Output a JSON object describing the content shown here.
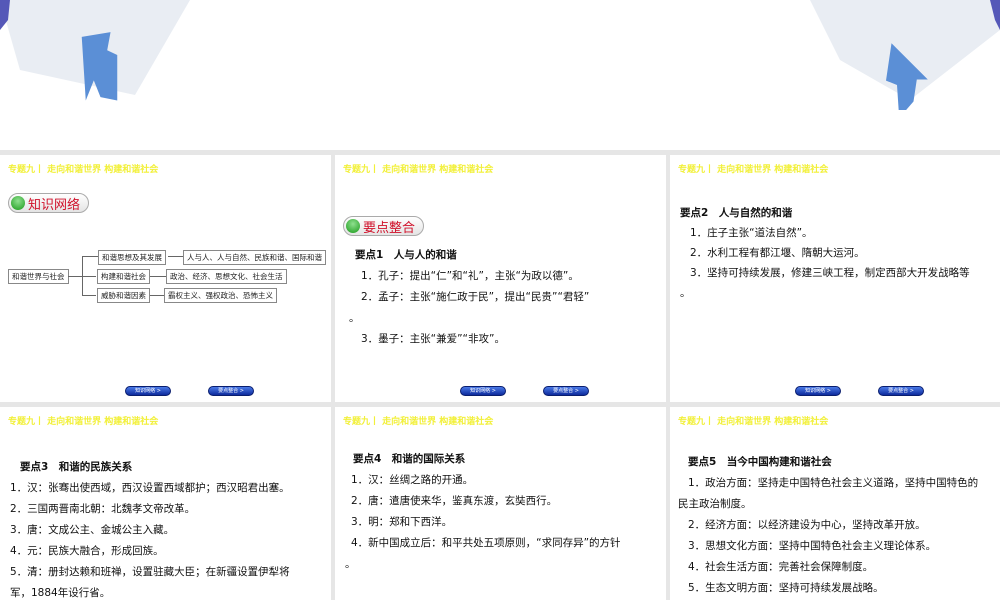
{
  "header": "专题九丨 走向和谐世界 构建和谐社会",
  "nav": {
    "knowledge": "知识网络 >",
    "points": "要点整合 >"
  },
  "slide1": {
    "pill": "知识网络",
    "root": "和谐世界与社会",
    "branches": [
      {
        "label": "和谐思想及其发展",
        "leaf": "人与人、人与自然、民族和谐、国际和谐"
      },
      {
        "label": "构建和谐社会",
        "leaf": "政治、经济、思想文化、社会生活"
      },
      {
        "label": "威胁和谐因素",
        "leaf": "霸权主义、强权政治、恐怖主义"
      }
    ]
  },
  "slide2": {
    "pill": "要点整合",
    "title": "要点1　人与人的和谐",
    "lines": [
      "1．孔子：提出“仁”和“礼”，主张“为政以德”。",
      "2．孟子：主张“施仁政于民”，提出“民贵”“君轻”",
      "。",
      "3．墨子：主张“兼爱”“非攻”。"
    ]
  },
  "slide3": {
    "title": "要点2　人与自然的和谐",
    "lines": [
      "1．庄子主张“道法自然”。",
      "2．水利工程有都江堰、隋朝大运河。",
      "3．坚持可持续发展，修建三峡工程，制定西部大开发战略等",
      "。"
    ]
  },
  "slide4": {
    "title": "要点3　和谐的民族关系",
    "lines": [
      "1．汉：张骞出使西域，西汉设置西域都护；西汉昭君出塞。",
      "2．三国两晋南北朝：北魏孝文帝改革。",
      "3．唐：文成公主、金城公主入藏。",
      "4．元：民族大融合，形成回族。",
      "5．清：册封达赖和班禅，设置驻藏大臣；在新疆设置伊犁将",
      "军，1884年设行省。"
    ]
  },
  "slide5": {
    "title": "要点4　和谐的国际关系",
    "lines": [
      "1．汉：丝绸之路的开通。",
      "2．唐：遣唐使来华，鉴真东渡，玄奘西行。",
      "3．明：郑和下西洋。",
      "4．新中国成立后：和平共处五项原则，“求同存异”的方针",
      "。"
    ]
  },
  "slide6": {
    "title": "要点5　当今中国构建和谐社会",
    "lines": [
      "1．政治方面：坚持走中国特色社会主义道路，坚持中国特色的",
      "民主政治制度。",
      "2．经济方面：以经济建设为中心，坚持改革开放。",
      "3．思想文化方面：坚持中国特色社会主义理论体系。",
      "4．社会生活方面：完善社会保障制度。",
      "5．生态文明方面：坚持可持续发展战略。"
    ]
  }
}
